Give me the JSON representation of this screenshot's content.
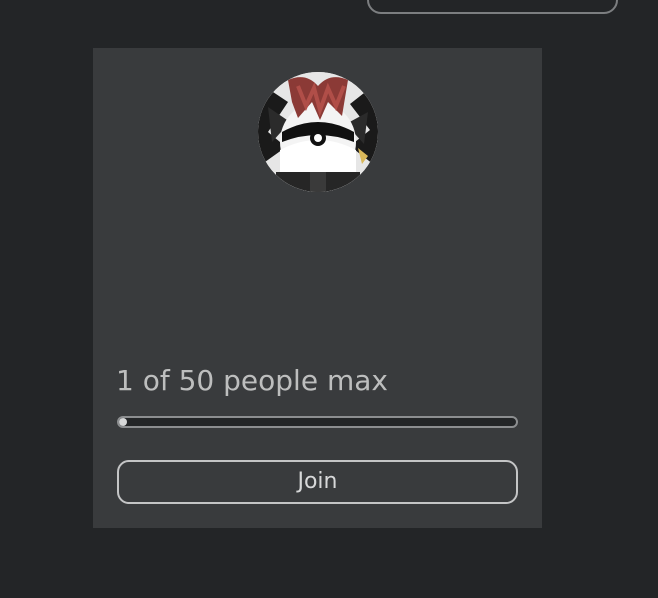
{
  "server": {
    "capacity_text": "1 of 50 people max",
    "players": 1,
    "max_players": 50,
    "join_label": "Join"
  },
  "colors": {
    "page_background": "#232527",
    "card_background": "#393b3d",
    "progress_fill": "#d7d8d9",
    "text": "#bdbebe"
  },
  "icons": {
    "avatar": "player-avatar-headshot"
  }
}
